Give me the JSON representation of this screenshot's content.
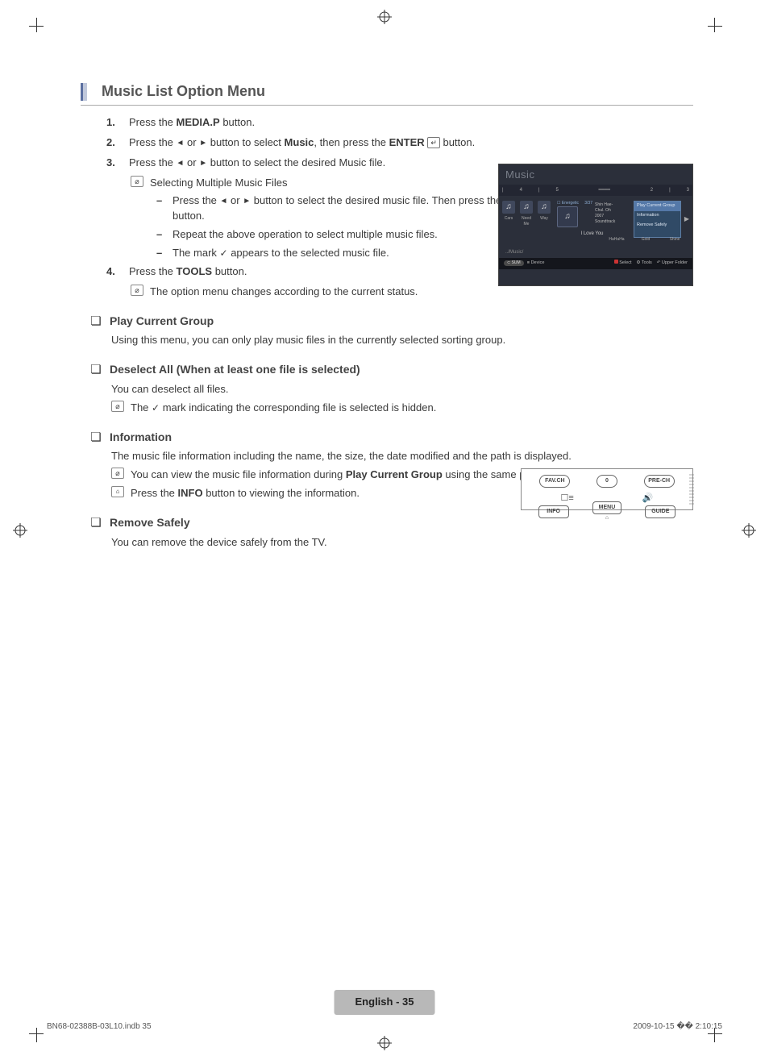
{
  "section": {
    "title": "Music List Option Menu"
  },
  "steps": {
    "s1_a": "Press the ",
    "s1_b": "MEDIA.P",
    "s1_c": " button.",
    "s2_a": "Press the ",
    "s2_b": " or ",
    "s2_c": " button to select ",
    "s2_d": "Music",
    "s2_e": ", then press the ",
    "s2_f": "ENTER",
    "s2_g": " button.",
    "s3_a": "Press the ",
    "s3_b": " or ",
    "s3_c": " button to select the desired Music file.",
    "s3_note_title": "Selecting Multiple Music Files",
    "s3_d1_a": "Press the ",
    "s3_d1_b": " or ",
    "s3_d1_c": " button to select the desired music file. Then press the Yellow button.",
    "s3_d2": "Repeat the above operation to select multiple music files.",
    "s3_d3_a": "The mark ",
    "s3_d3_b": " appears to the selected music file.",
    "s4_a": "Press the ",
    "s4_b": "TOOLS",
    "s4_c": " button.",
    "s4_note": "The option menu changes according to the current status."
  },
  "q1": {
    "title": "Play Current Group",
    "body": "Using this menu, you can only play music files in the currently selected sorting group."
  },
  "q2": {
    "title": "Deselect All (When at least one file is selected)",
    "body": "You can deselect all files.",
    "note_a": "The ",
    "note_b": " mark indicating the corresponding file is selected is hidden."
  },
  "q3": {
    "title": "Information",
    "body": "The music file information including the name, the size, the date modified and the path is displayed.",
    "note1_a": "You can view the music file information during ",
    "note1_b": "Play Current Group",
    "note1_c": " using the same procedures.",
    "note2_a": "Press the ",
    "note2_b": "INFO",
    "note2_c": " button to viewing the information."
  },
  "q4": {
    "title": "Remove Safely",
    "body": "You can remove the device safely from the TV."
  },
  "tv": {
    "title": "Music",
    "ruler": {
      "a": "4",
      "b": "5",
      "c": "2",
      "d": "3"
    },
    "thumbs": {
      "t1": "Cars",
      "t2": "Need Me",
      "t3": "Way",
      "r1": "HaHaHa",
      "r2": "Gold",
      "r3": "Shine"
    },
    "focus": {
      "tag": "Energetic",
      "idx": "3/37",
      "l1": "Shin Hae-",
      "l2": "Chul. Oh",
      "l3": "2007",
      "l4": "Soundtrack",
      "song": "I Love You"
    },
    "menu": {
      "m1": "Play Current Group",
      "m2": "Information",
      "m3": "Remove Safely"
    },
    "path": "../Music/",
    "footer": {
      "sum": "SUM",
      "device": "Device",
      "select": "Select",
      "tools": "Tools",
      "upper": "Upper Folder"
    }
  },
  "remote": {
    "fav": "FAV.CH",
    "zero": "0",
    "pre": "PRE-CH",
    "info": "INFO",
    "menu": "MENU",
    "guide": "GUIDE"
  },
  "footer": {
    "tab": "English - 35",
    "left": "BN68-02388B-03L10.indb   35",
    "right": "2009-10-15   �� 2:10:15"
  }
}
